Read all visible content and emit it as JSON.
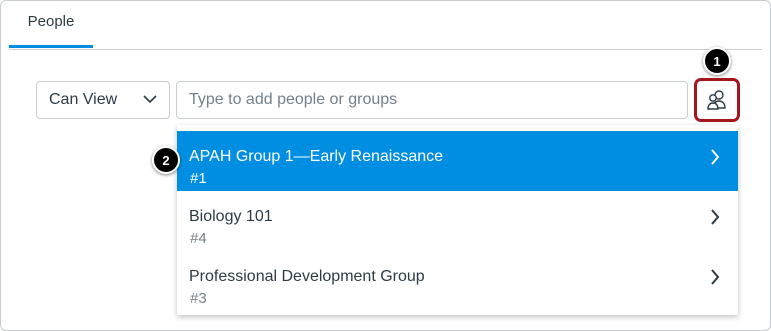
{
  "tabs": [
    {
      "label": "People"
    }
  ],
  "permission": {
    "selected": "Can View"
  },
  "search": {
    "placeholder": "Type to add people or groups"
  },
  "callouts": [
    "1",
    "2"
  ],
  "dropdown": {
    "items": [
      {
        "name": "APAH Group 1—Early Renaissance",
        "sub": "#1",
        "active": true
      },
      {
        "name": "Biology 101",
        "sub": "#4",
        "active": false
      },
      {
        "name": "Professional Development Group",
        "sub": "#3",
        "active": false
      }
    ]
  },
  "colors": {
    "accent": "#008ee2",
    "highlight_border": "#a5161c",
    "text": "#2d3b45",
    "muted": "#73818c"
  },
  "icons": {
    "browse": "people-icon",
    "select": "chevron-down-icon",
    "item": "chevron-right-icon"
  }
}
